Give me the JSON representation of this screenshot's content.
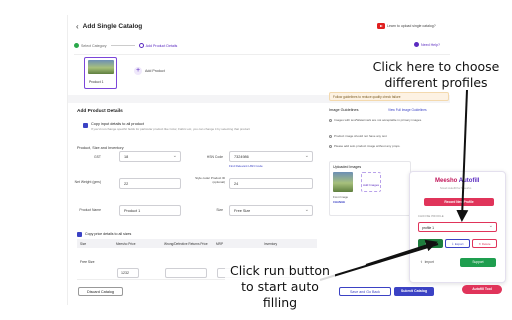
{
  "header": {
    "title": "Add Single Catalog",
    "youtube_text": "Learn to upload single catalog?"
  },
  "steps": [
    {
      "label": "Select Category"
    },
    {
      "label": "Add Product Details"
    }
  ],
  "help_label": "Need Help?",
  "product_strip": {
    "thumb_label": "Product 1",
    "add_label": "Add Product"
  },
  "form": {
    "section_title": "Add Product Details",
    "copy_main": "Copy input details to all product",
    "copy_sub": "If you'd not change specific fields for particular product like Color, Fabric etc, you can change it by selecting that product",
    "sub_title": "Product, Size and Inventory",
    "gst_label": "GST",
    "gst_value": "18",
    "hsn_label": "HSN Code",
    "hsn_value": "7324986",
    "hsn_link": "Find Relevant HSN Code",
    "weight_label": "Net Weight (gms)",
    "weight_value": "22",
    "style_label": "Style code/ Product ID (optional)",
    "style_value": "24",
    "name_label": "Product Name",
    "name_value": "Product 1",
    "size_label": "Size",
    "size_value": "Free Size",
    "copy_all": "Copy price details to all sizes",
    "table_headers": [
      "Size",
      "Meesho Price",
      "Wrong/Defective Returns Price",
      "MRP",
      "Inventory"
    ],
    "row_size": "Free Size",
    "row_price": "1232"
  },
  "footer": {
    "discard": "Discard Catalog",
    "save": "Save and Go Back",
    "submit": "Submit Catalog"
  },
  "right_panel": {
    "notice": "Follow guidelines to reduce quality check failure",
    "guide_title": "Image Guidelines",
    "guide_link": "View Full Image Guidelines",
    "guidelines": [
      "Images with text/Watermark are not acceptable in primary images.",
      "Product image should not have any text",
      "Please add solo product image without any props."
    ],
    "uploaded_title": "Uploaded Images",
    "add_images": "Add Images",
    "front_image": "Front Image",
    "change": "CHANGE"
  },
  "extension": {
    "brand_m": "Meesho",
    "brand_a": " Autofill",
    "subtitle": "Smart Autofill for Meesho",
    "record_btn": "Record New Profile",
    "profile_label": "CHOOSE PROFILE",
    "profile_value": "profile 1",
    "run": "Run",
    "export": "Export",
    "delete": "Delete",
    "import": "Import",
    "support": "Support",
    "autofill_tool": "Autofill Tool"
  },
  "annotations": {
    "profiles": "Click here to choose different profiles",
    "run": "Click run button to start auto filling"
  },
  "colors": {
    "accent": "#3b42c4",
    "brand_pink": "#e0345a",
    "run_green": "#1e7d3d"
  }
}
